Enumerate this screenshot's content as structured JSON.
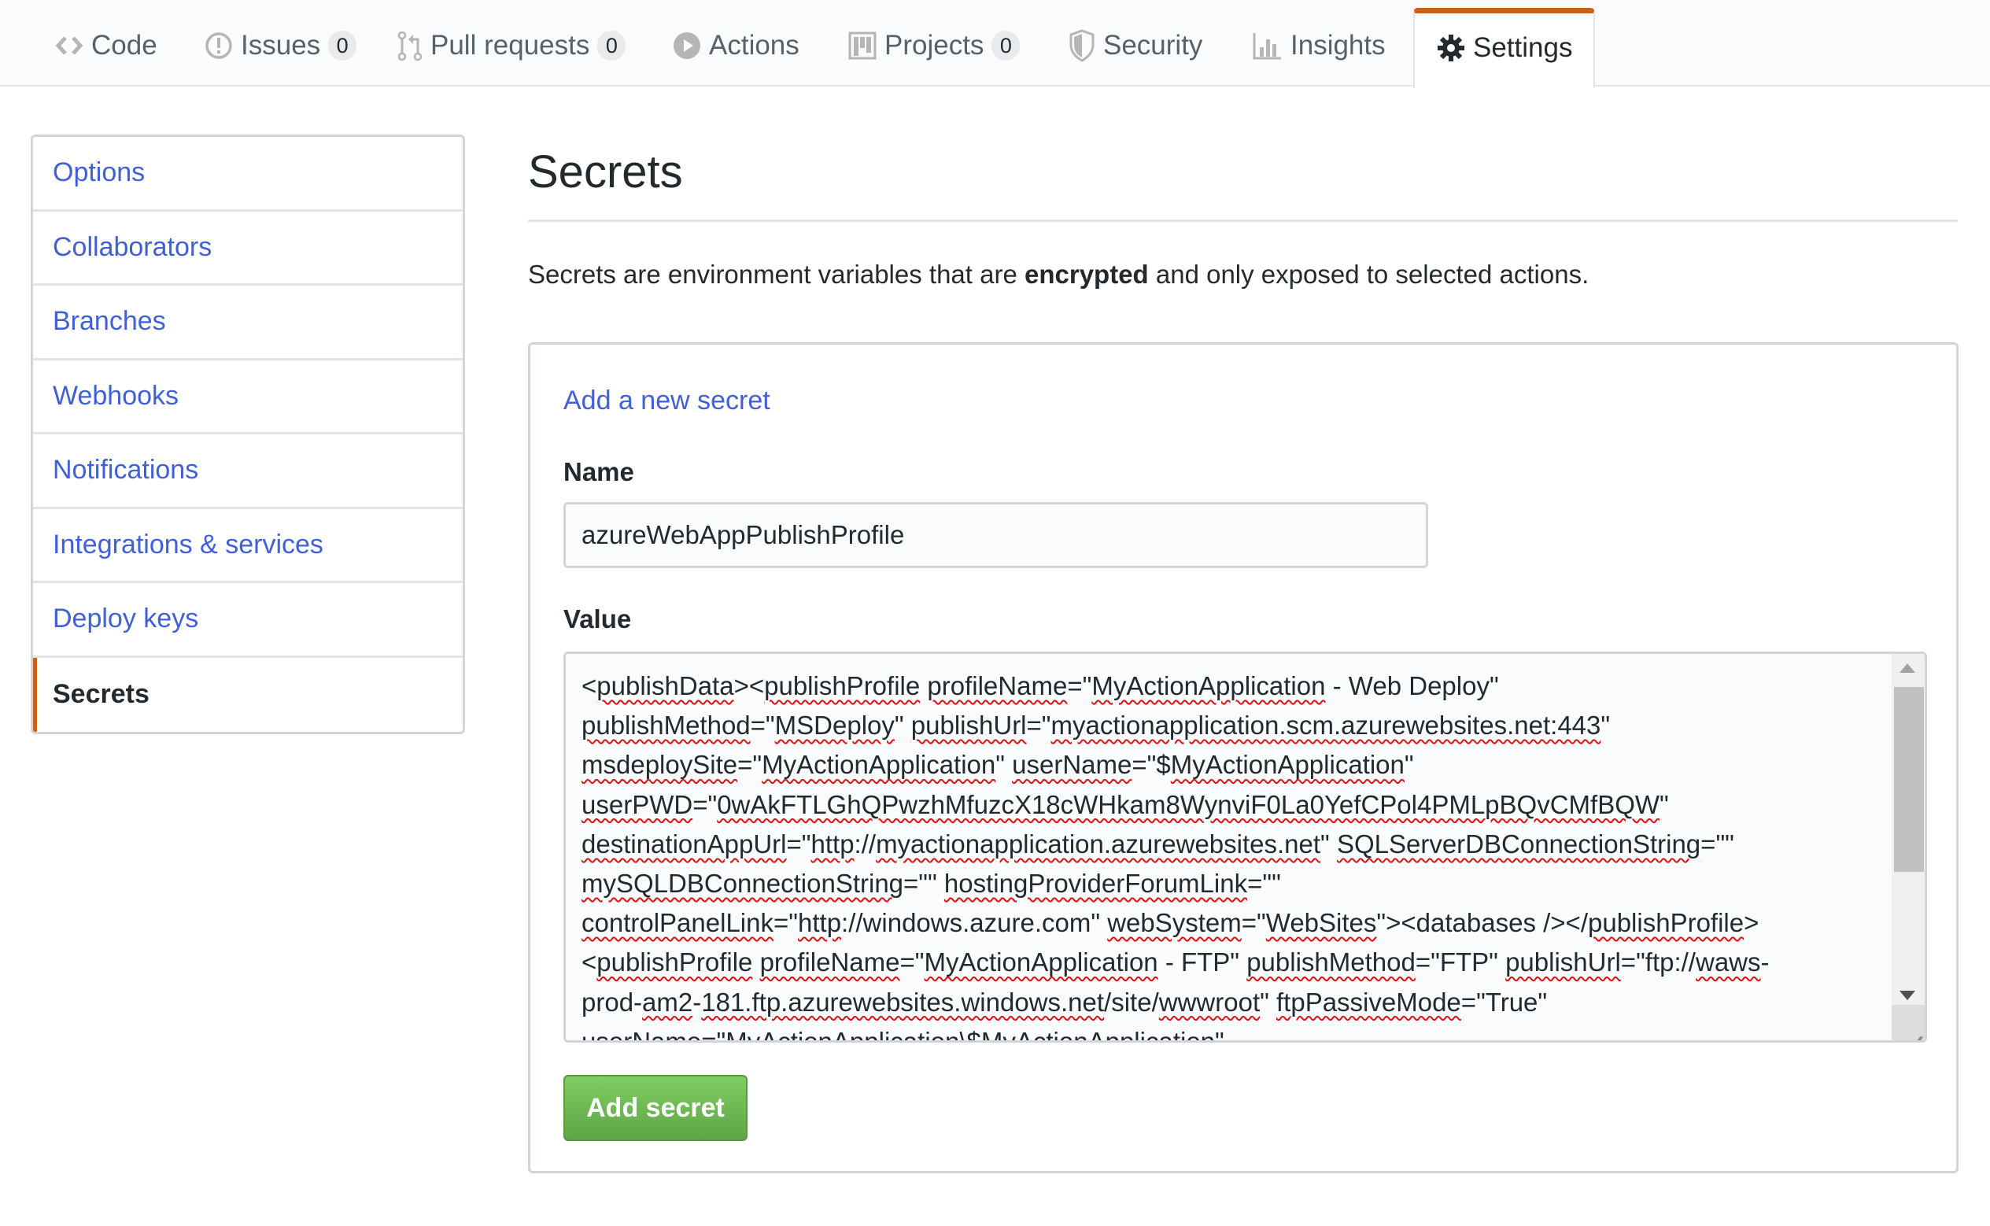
{
  "tabs": [
    {
      "label": "Code",
      "icon": "code-icon",
      "counter": null,
      "selected": false
    },
    {
      "label": "Issues",
      "icon": "issue-icon",
      "counter": "0",
      "selected": false
    },
    {
      "label": "Pull requests",
      "icon": "pull-request-icon",
      "counter": "0",
      "selected": false
    },
    {
      "label": "Actions",
      "icon": "play-icon",
      "counter": null,
      "selected": false
    },
    {
      "label": "Projects",
      "icon": "project-icon",
      "counter": "0",
      "selected": false
    },
    {
      "label": "Security",
      "icon": "shield-icon",
      "counter": null,
      "selected": false
    },
    {
      "label": "Insights",
      "icon": "graph-icon",
      "counter": null,
      "selected": false
    },
    {
      "label": "Settings",
      "icon": "gear-icon",
      "counter": null,
      "selected": true
    }
  ],
  "sidebar": {
    "items": [
      {
        "label": "Options",
        "active": false
      },
      {
        "label": "Collaborators",
        "active": false
      },
      {
        "label": "Branches",
        "active": false
      },
      {
        "label": "Webhooks",
        "active": false
      },
      {
        "label": "Notifications",
        "active": false
      },
      {
        "label": "Integrations & services",
        "active": false
      },
      {
        "label": "Deploy keys",
        "active": false
      },
      {
        "label": "Secrets",
        "active": true
      }
    ]
  },
  "main": {
    "title": "Secrets",
    "description_pre": "Secrets are environment variables that are ",
    "description_bold": "encrypted",
    "description_post": " and only exposed to selected actions.",
    "form": {
      "heading": "Add a new secret",
      "name_label": "Name",
      "name_value": "azureWebAppPublishProfile",
      "value_label": "Value",
      "value_text": "<publishData><publishProfile profileName=\"MyActionApplication - Web Deploy\" publishMethod=\"MSDeploy\" publishUrl=\"myactionapplication.scm.azurewebsites.net:443\" msdeploySite=\"MyActionApplication\" userName=\"$MyActionApplication\" userPWD=\"0wAkFTLGhQPwzhMfuzcX18cWHkam8WynviF0La0YefCPol4PMLpBQvCMfBQW\" destinationAppUrl=\"http://myactionapplication.azurewebsites.net\" SQLServerDBConnectionString=\"\" mySQLDBConnectionString=\"\" hostingProviderForumLink=\"\" controlPanelLink=\"http://windows.azure.com\" webSystem=\"WebSites\"><databases /></publishProfile><publishProfile profileName=\"MyActionApplication - FTP\" publishMethod=\"FTP\" publishUrl=\"ftp://waws-prod-am2-181.ftp.azurewebsites.windows.net/site/wwwroot\" ftpPassiveMode=\"True\" userName=\"MyActionApplication\\$MyActionApplication\"",
      "value_lines": [
        [
          [
            "<",
            0
          ],
          [
            "publishData",
            1
          ],
          [
            "><",
            0
          ],
          [
            "publishProfile",
            1
          ],
          [
            " ",
            0
          ],
          [
            "profileName",
            1
          ],
          [
            "=\"",
            0
          ],
          [
            "MyActionApplication",
            1
          ],
          [
            " - Web Deploy\"",
            0
          ]
        ],
        [
          [
            "publishMethod",
            1
          ],
          [
            "=\"",
            0
          ],
          [
            "MSDeploy",
            1
          ],
          [
            "\" ",
            0
          ],
          [
            "publishUrl",
            1
          ],
          [
            "=\"",
            0
          ],
          [
            "myactionapplication.scm.azurewebsites.net:443",
            1
          ],
          [
            "\"",
            0
          ]
        ],
        [
          [
            "msdeploySite",
            1
          ],
          [
            "=\"",
            0
          ],
          [
            "MyActionApplication",
            1
          ],
          [
            "\" ",
            0
          ],
          [
            "userName",
            1
          ],
          [
            "=\"$",
            0
          ],
          [
            "MyActionApplication",
            1
          ],
          [
            "\"",
            0
          ]
        ],
        [
          [
            "userPWD",
            1
          ],
          [
            "=\"",
            0
          ],
          [
            "0wAkFTLGhQPwzhMfuzcX18cWHkam8WynviF0La0YefCPol4PMLpBQvCMfBQW",
            1
          ],
          [
            "\"",
            0
          ]
        ],
        [
          [
            "destinationAppUrl",
            1
          ],
          [
            "=\"",
            0
          ],
          [
            "http",
            1
          ],
          [
            "://",
            0
          ],
          [
            "myactionapplication.azurewebsites.net",
            1
          ],
          [
            "\" ",
            0
          ],
          [
            "SQLServerDBConnectionString",
            1
          ],
          [
            "=\"\"",
            0
          ]
        ],
        [
          [
            "mySQLDBConnectionString",
            1
          ],
          [
            "=\"\" ",
            0
          ],
          [
            "hostingProviderForumLink",
            1
          ],
          [
            "=\"\"",
            0
          ]
        ],
        [
          [
            "controlPanelLink",
            1
          ],
          [
            "=\"",
            0
          ],
          [
            "http",
            1
          ],
          [
            "://windows.azure.com\" ",
            0
          ],
          [
            "webSystem",
            1
          ],
          [
            "=\"",
            0
          ],
          [
            "WebSites",
            1
          ],
          [
            "\"><databases /></",
            0
          ],
          [
            "publishProfile",
            1
          ],
          [
            ">",
            0
          ]
        ],
        [
          [
            "<",
            0
          ],
          [
            "publishProfile",
            1
          ],
          [
            " ",
            0
          ],
          [
            "profileName",
            1
          ],
          [
            "=\"",
            0
          ],
          [
            "MyActionApplication",
            1
          ],
          [
            " - FTP\" ",
            0
          ],
          [
            "publishMethod",
            1
          ],
          [
            "=\"FTP\" ",
            0
          ],
          [
            "publishUrl",
            1
          ],
          [
            "=\"ftp://",
            0
          ],
          [
            "waws",
            1
          ],
          [
            "-",
            0
          ]
        ],
        [
          [
            "prod-",
            0
          ],
          [
            "am2",
            1
          ],
          [
            "-",
            0
          ],
          [
            "181.ftp.azurewebsites.windows.net",
            1
          ],
          [
            "/site/",
            0
          ],
          [
            "wwwroot",
            1
          ],
          [
            "\" ",
            0
          ],
          [
            "ftpPassiveMode",
            1
          ],
          [
            "=\"True\"",
            0
          ]
        ],
        [
          [
            "userName=\"MyActionApplication\\$MyActionApplication\"",
            0
          ]
        ]
      ],
      "submit_label": "Add secret"
    }
  },
  "colors": {
    "accent_orange": "#c6621a",
    "link_blue": "#4160d6",
    "button_green": "#6bb850"
  }
}
